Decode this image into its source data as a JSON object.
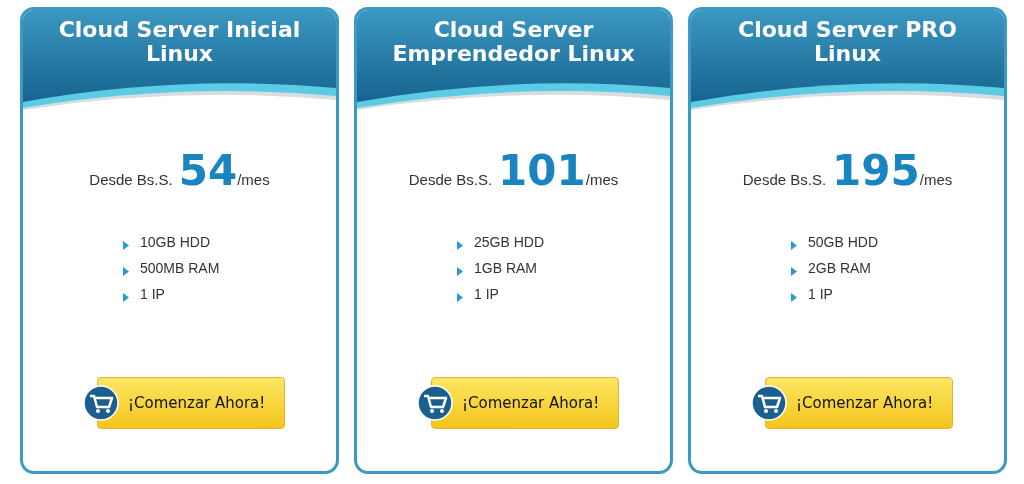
{
  "plans": [
    {
      "title": "Cloud Server Inicial Linux",
      "price_prefix": "Desde Bs.S.",
      "price": "54",
      "price_suffix": "/mes",
      "features": [
        "10GB HDD",
        "500MB RAM",
        "1 IP"
      ],
      "button": "¡Comenzar Ahora!"
    },
    {
      "title": "Cloud Server Emprendedor Linux",
      "price_prefix": "Desde Bs.S.",
      "price": "101",
      "price_suffix": "/mes",
      "features": [
        "25GB HDD",
        "1GB RAM",
        "1 IP"
      ],
      "button": "¡Comenzar Ahora!"
    },
    {
      "title": "Cloud Server PRO Linux",
      "price_prefix": "Desde Bs.S.",
      "price": "195",
      "price_suffix": "/mes",
      "features": [
        "50GB HDD",
        "2GB RAM",
        "1 IP"
      ],
      "button": "¡Comenzar Ahora!"
    }
  ]
}
